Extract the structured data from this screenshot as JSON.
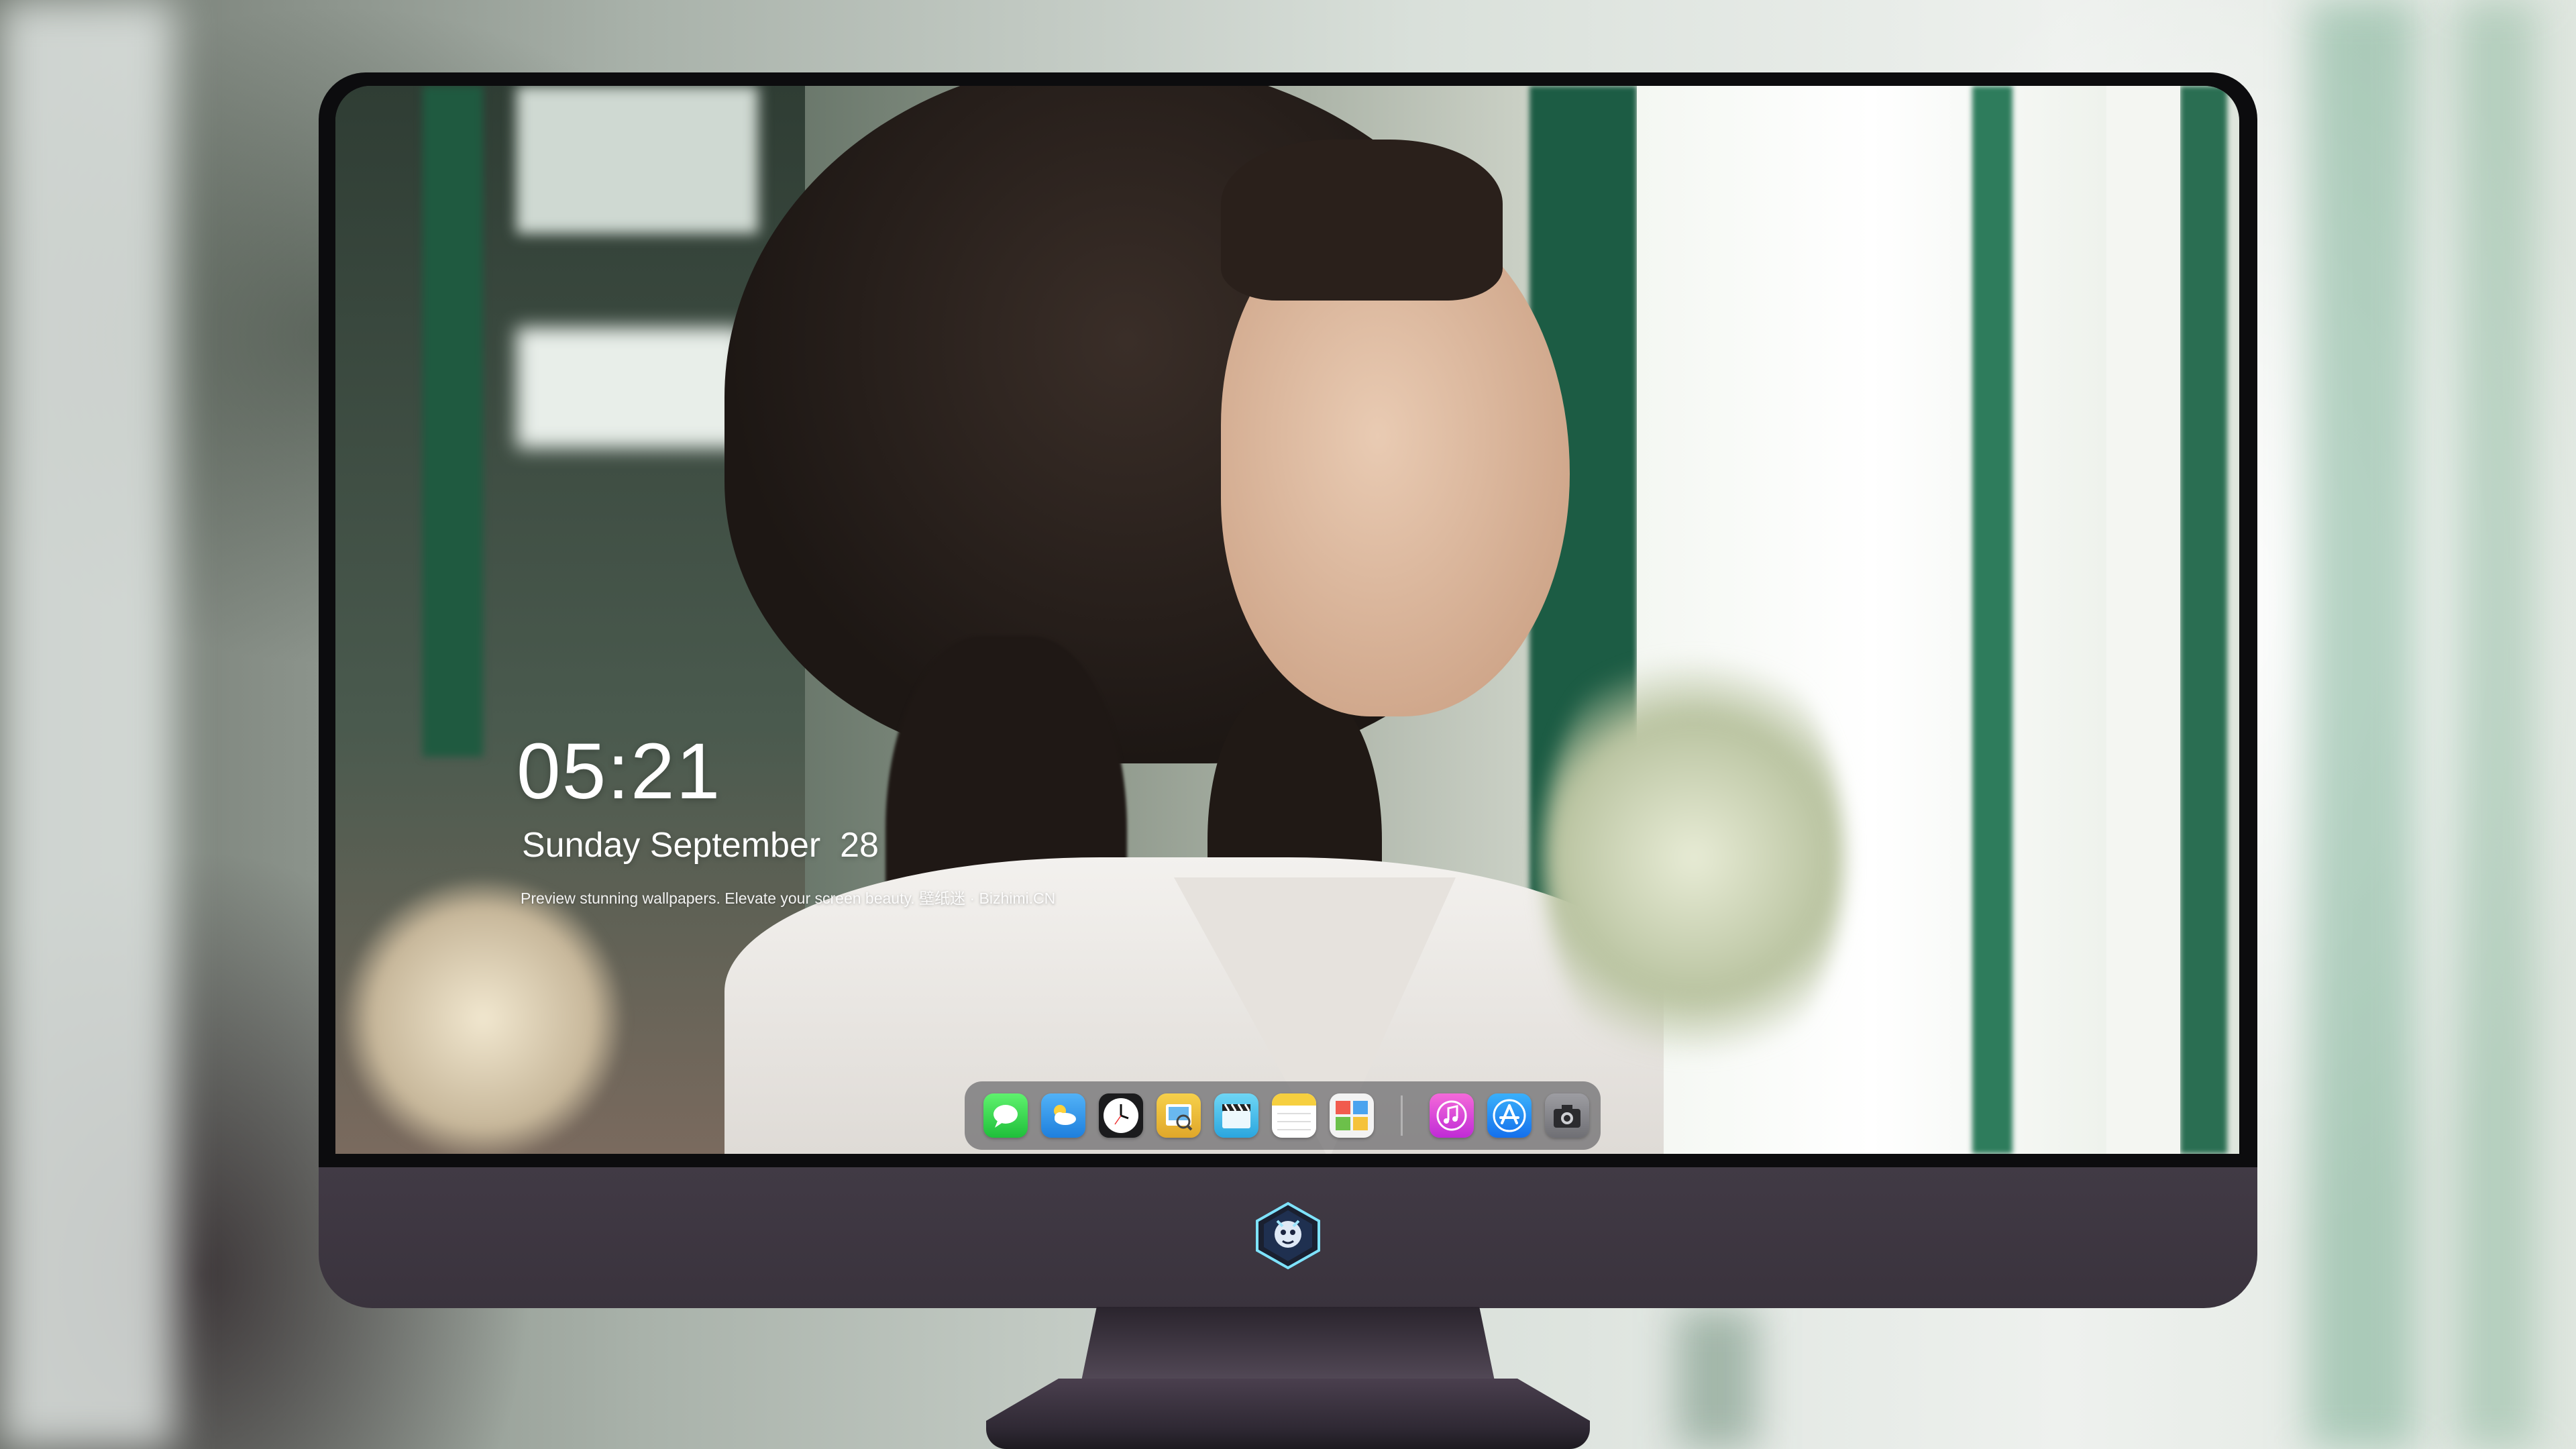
{
  "lock_screen": {
    "time": "05:21",
    "date": "Sunday September  28",
    "tagline": "Preview stunning wallpapers. Elevate your screen beauty. 壁纸迷 · Bizhimi.CN"
  },
  "dock": {
    "apps": [
      {
        "name": "messages-icon",
        "color": "#2bd14a"
      },
      {
        "name": "weather-icon",
        "color": "#3a9ff0"
      },
      {
        "name": "clock-icon",
        "color": "#ffffff"
      },
      {
        "name": "preview-icon",
        "color": "#f2c233"
      },
      {
        "name": "video-editor-icon",
        "color": "#3fb9e8"
      },
      {
        "name": "notes-icon",
        "color": "#f6d34a"
      },
      {
        "name": "photo-booth-icon",
        "color": "#6fbf4a"
      },
      {
        "name": "music-icon",
        "color": "#e94fe0"
      },
      {
        "name": "app-store-icon",
        "color": "#1f8df5"
      },
      {
        "name": "camera-icon",
        "color": "#8a8a8f"
      }
    ]
  },
  "monitor": {
    "bezel_color": "#0c0c0e",
    "chin_color": "#3e3741",
    "logo_name": "dragon-shield-logo"
  }
}
